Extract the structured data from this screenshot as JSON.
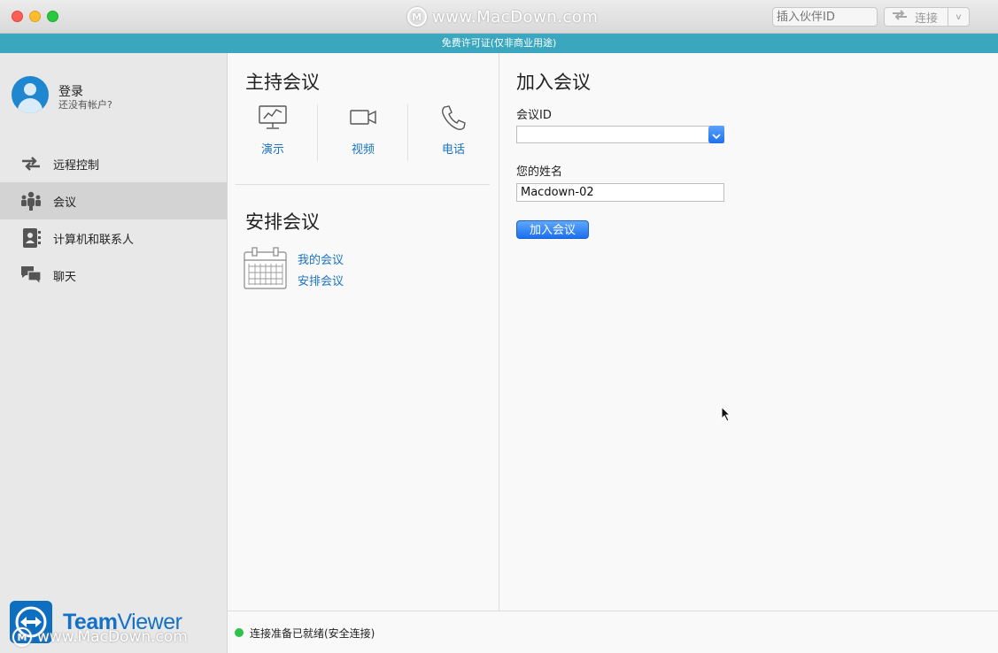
{
  "window": {
    "watermark": "www.MacDown.com",
    "watermark_logo": "M",
    "partner_id_placeholder": "插入伙伴ID",
    "connect_label": "连接",
    "connect_dropdown": "v"
  },
  "license_banner": "免费许可证(仅非商业用途)",
  "sidebar": {
    "login_title": "登录",
    "login_subtitle": "还没有帐户?",
    "items": [
      {
        "label": "远程控制",
        "icon": "arrows-icon",
        "active": false
      },
      {
        "label": "会议",
        "icon": "people-icon",
        "active": true
      },
      {
        "label": "计算机和联系人",
        "icon": "contacts-icon",
        "active": false
      },
      {
        "label": "聊天",
        "icon": "chat-icon",
        "active": false
      }
    ],
    "brand_bold": "Team",
    "brand_light": "Viewer",
    "watermark": "www.MacDown.com"
  },
  "host": {
    "title": "主持会议",
    "items": [
      {
        "label": "演示",
        "icon": "presentation-icon"
      },
      {
        "label": "视频",
        "icon": "video-camera-icon"
      },
      {
        "label": "电话",
        "icon": "phone-icon"
      }
    ]
  },
  "schedule": {
    "title": "安排会议",
    "links": [
      "我的会议",
      "安排会议"
    ]
  },
  "join": {
    "title": "加入会议",
    "meeting_id_label": "会议ID",
    "meeting_id_value": "",
    "name_label": "您的姓名",
    "name_value": "Macdown-02",
    "join_button": "加入会议"
  },
  "status": {
    "text": "连接准备已就绪(安全连接)",
    "color": "#2ec24a"
  },
  "colors": {
    "accent": "#1a73c4",
    "banner": "#3aa7bf",
    "brand": "#1471c5"
  }
}
